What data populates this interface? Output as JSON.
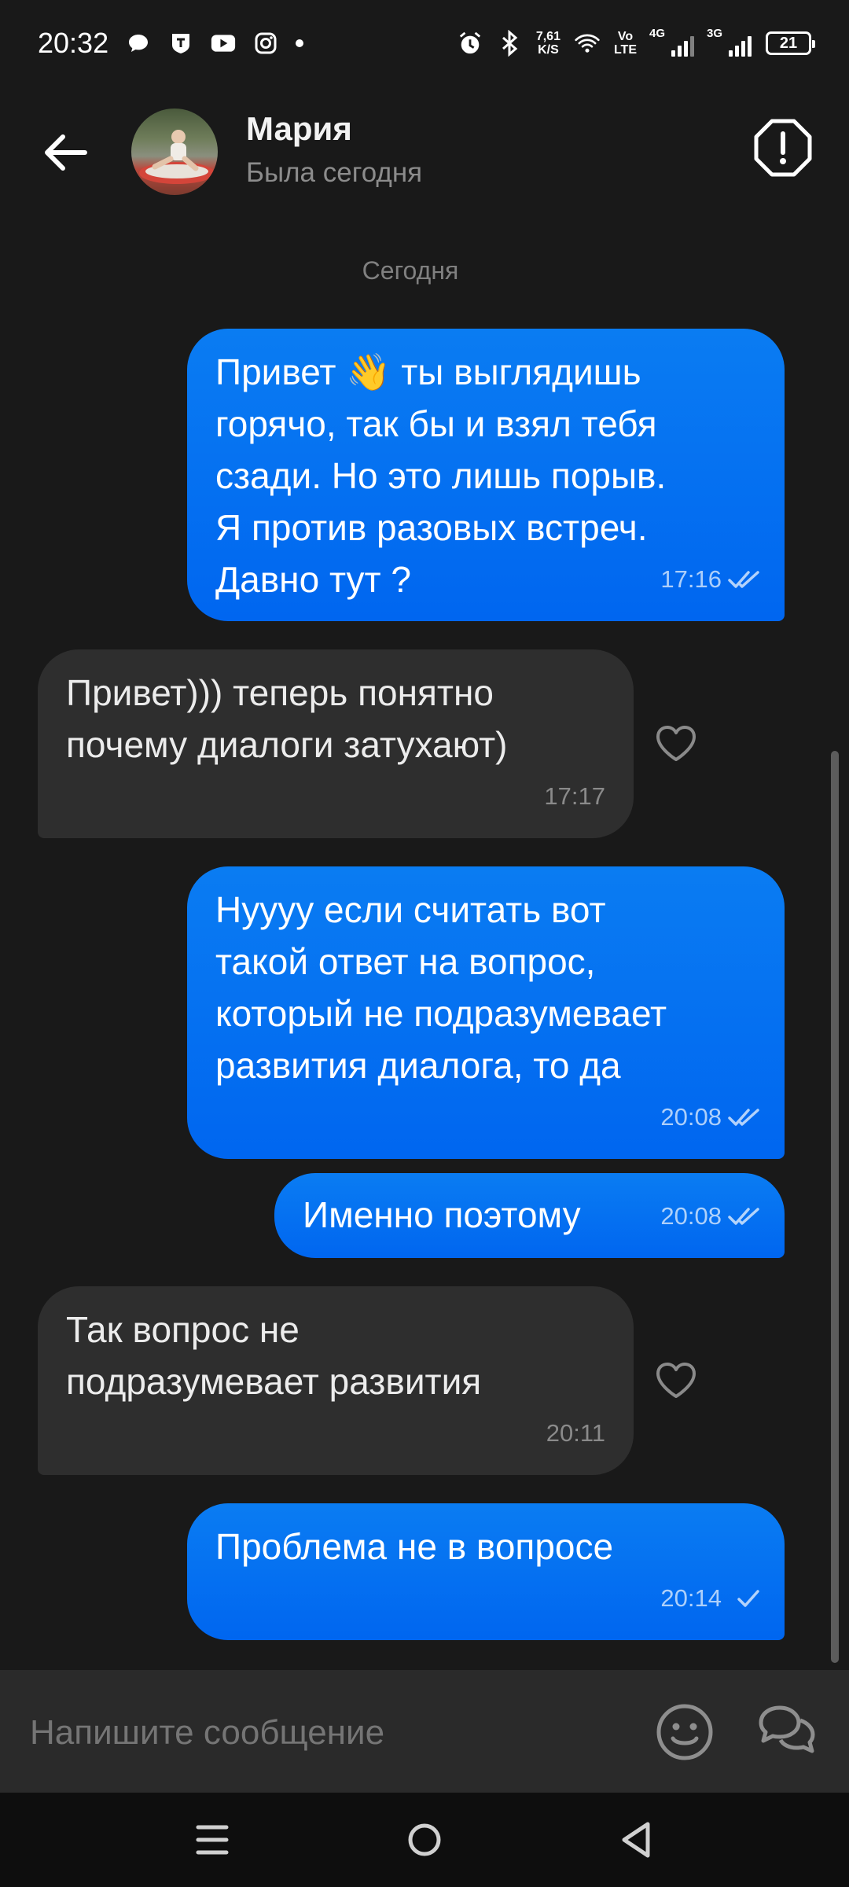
{
  "status_bar": {
    "time": "20:32",
    "net_speed_value": "7,61",
    "net_speed_unit": "K/S",
    "volte_top": "Vo",
    "volte_bottom": "LTE",
    "sim1_label": "4G",
    "sim2_label": "3G",
    "battery": "21",
    "notification_icons": [
      "chat-bubble-icon",
      "shield-app-icon",
      "youtube-icon",
      "instagram-icon"
    ],
    "system_icons": [
      "alarm-icon",
      "bluetooth-icon",
      "wifi-icon"
    ]
  },
  "header": {
    "name": "Мария",
    "status": "Была сегодня"
  },
  "date_divider": "Сегодня",
  "messages": [
    {
      "direction": "out",
      "text": "Привет 👋 ты выглядишь\nгорячо, так бы и взял тебя\nсзади. Но это лишь порыв.\nЯ против разовых встреч.\nДавно тут ?",
      "time": "17:16",
      "status": "read"
    },
    {
      "direction": "in",
      "text": "Привет))) теперь понятно\nпочему диалоги затухают)",
      "time": "17:17"
    },
    {
      "direction": "out",
      "text": "Нуууу если считать вот\nтакой ответ на вопрос,\nкоторый не подразумевает\nразвития диалога, то да",
      "time": "20:08",
      "status": "read"
    },
    {
      "direction": "out",
      "text": "Именно поэтому",
      "time": "20:08",
      "status": "read"
    },
    {
      "direction": "in",
      "text": "Так вопрос не\nподразумевает развития",
      "time": "20:11"
    },
    {
      "direction": "out",
      "text": "Проблема не в вопросе",
      "time": "20:14",
      "status": "sent"
    }
  ],
  "composer": {
    "placeholder": "Напишите сообщение"
  },
  "colors": {
    "background": "#191919",
    "outgoing_bubble": "#0070f0",
    "incoming_bubble": "#2e2e2e",
    "composer": "#2a2a2a"
  }
}
